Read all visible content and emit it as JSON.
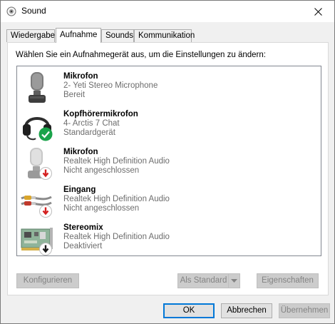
{
  "window": {
    "title": "Sound",
    "tabs": [
      "Wiedergabe",
      "Aufnahme",
      "Sounds",
      "Kommunikation"
    ]
  },
  "panel": {
    "instruction": "Wählen Sie ein Aufnahmegerät aus, um die Einstellungen zu ändern:",
    "devices": [
      {
        "name": "Mikrofon",
        "sub": "2- Yeti Stereo Microphone",
        "status": "Bereit",
        "icon": "microphone-icon",
        "badge": ""
      },
      {
        "name": "Kopfhörermikrofon",
        "sub": "4- Arctis 7 Chat",
        "status": "Standardgerät",
        "icon": "headset-icon",
        "badge": "default-checkmark-icon"
      },
      {
        "name": "Mikrofon",
        "sub": "Realtek High Definition Audio",
        "status": "Nicht angeschlossen",
        "icon": "microphone-icon",
        "badge": "disconnected-arrow-icon"
      },
      {
        "name": "Eingang",
        "sub": "Realtek High Definition Audio",
        "status": "Nicht angeschlossen",
        "icon": "line-in-cable-icon",
        "badge": "disconnected-arrow-icon"
      },
      {
        "name": "Stereomix",
        "sub": "Realtek High Definition Audio",
        "status": "Deaktiviert",
        "icon": "sound-card-icon",
        "badge": "disabled-arrow-icon"
      }
    ],
    "configure_label": "Konfigurieren",
    "set_default_label": "Als Standard",
    "properties_label": "Eigenschaften"
  },
  "footer": {
    "ok_label": "OK",
    "cancel_label": "Abbrechen",
    "apply_label": "Übernehmen"
  },
  "colors": {
    "accent": "#0078d7",
    "default_badge": "#1aa34a",
    "disconnected_badge": "#d42020"
  }
}
